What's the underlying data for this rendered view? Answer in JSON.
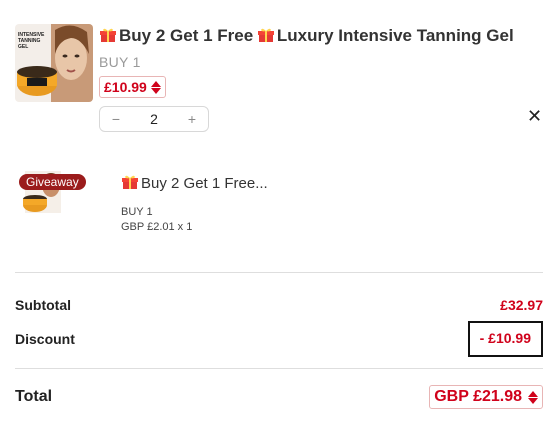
{
  "item1": {
    "title": "Buy 2 Get 1 Free",
    "title_suffix": "Luxury Intensive Tanning Gel",
    "product_image_label": "INTENSIVE TANNING GEL",
    "variant": "BUY 1",
    "price": "£10.99",
    "quantity": "2",
    "decrement_label": "−",
    "increment_label": "+",
    "remove_label": "✕"
  },
  "item2": {
    "badge": "Giveaway",
    "title": "Buy 2 Get 1 Free...",
    "variant": "BUY 1",
    "price_line": "GBP £2.01 x 1"
  },
  "summary": {
    "subtotal_label": "Subtotal",
    "subtotal_value": "£32.97",
    "discount_label": "Discount",
    "discount_value": "-  £10.99",
    "total_label": "Total",
    "total_value": "GBP £21.98"
  },
  "colors": {
    "accent_red": "#d0021b",
    "badge_red": "#9b1c1c"
  }
}
